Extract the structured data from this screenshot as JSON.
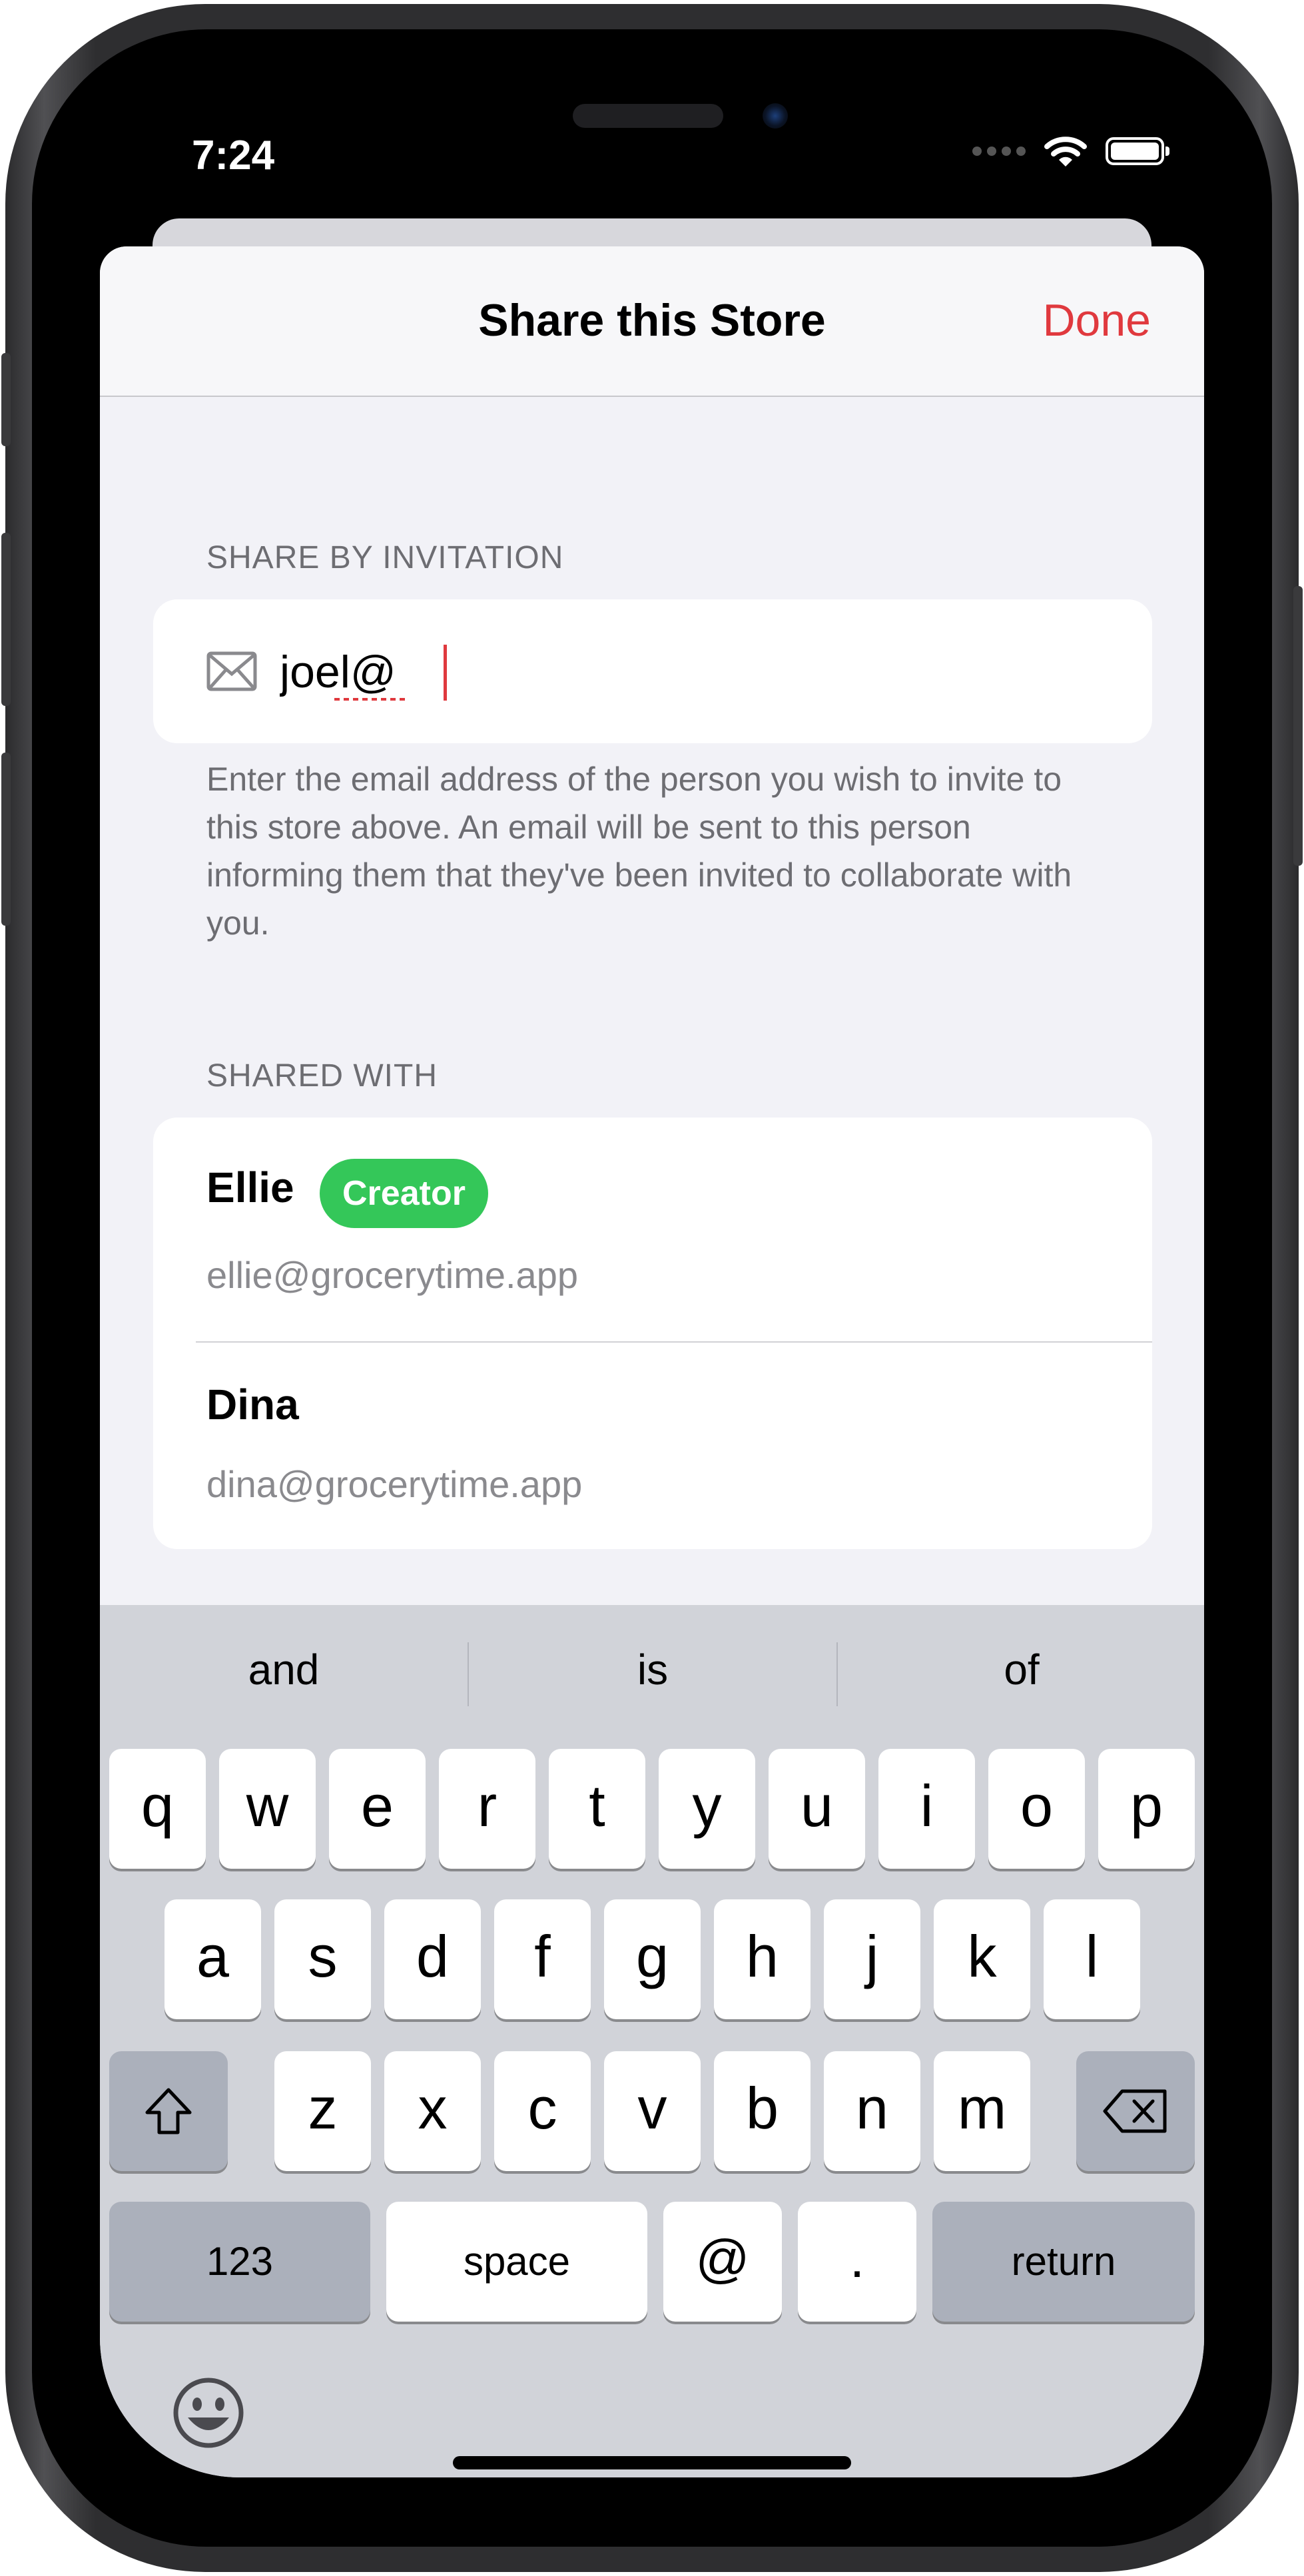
{
  "status": {
    "time": "7:24"
  },
  "nav": {
    "title": "Share this Store",
    "done_label": "Done"
  },
  "invite": {
    "header": "SHARE BY INVITATION",
    "email_value": "joel@",
    "help_text": "Enter the email address of the person you wish to invite to this store above. An email will be sent to this person informing them that they've been invited to collaborate with you."
  },
  "shared": {
    "header": "SHARED WITH",
    "people": [
      {
        "name": "Ellie",
        "badge": "Creator",
        "email": "ellie@grocerytime.app"
      },
      {
        "name": "Dina",
        "email": "dina@grocerytime.app"
      }
    ]
  },
  "keyboard": {
    "suggestions": [
      "and",
      "is",
      "of"
    ],
    "row1": [
      "q",
      "w",
      "e",
      "r",
      "t",
      "y",
      "u",
      "i",
      "o",
      "p"
    ],
    "row2": [
      "a",
      "s",
      "d",
      "f",
      "g",
      "h",
      "j",
      "k",
      "l"
    ],
    "row3": [
      "z",
      "x",
      "c",
      "v",
      "b",
      "n",
      "m"
    ],
    "numbers_label": "123",
    "space_label": "space",
    "at_label": "@",
    "dot_label": ".",
    "return_label": "return"
  },
  "colors": {
    "accent": "#e0393e",
    "badge": "#34c759",
    "background": "#f2f2f7"
  },
  "icons": [
    "mail-icon",
    "shift-icon",
    "delete-icon",
    "emoji-icon",
    "wifi-icon",
    "battery-icon"
  ]
}
